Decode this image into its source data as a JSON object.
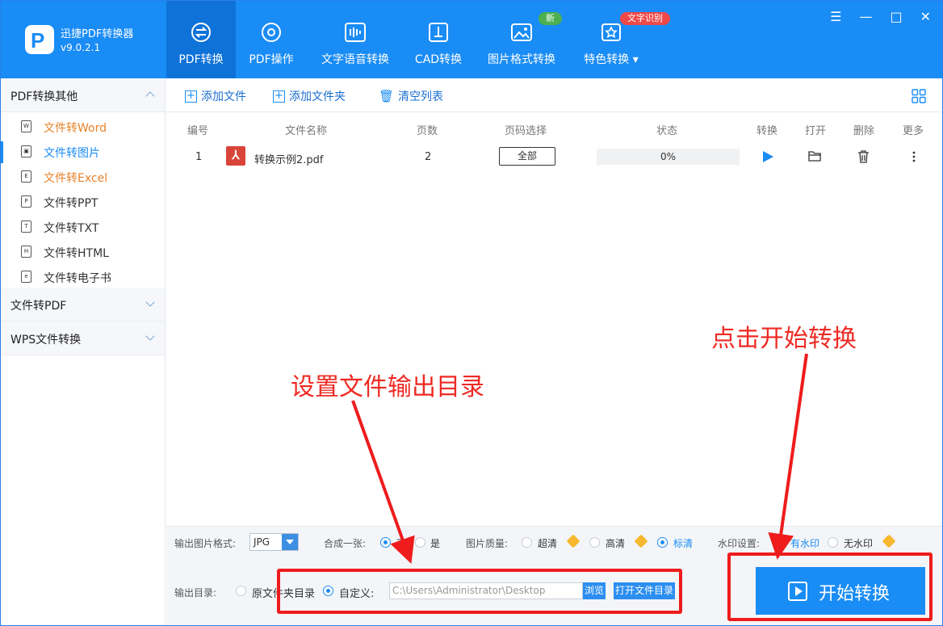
{
  "app": {
    "name": "迅捷PDF转换器",
    "version": "v9.0.2.1",
    "logo_letter": "P"
  },
  "tabs": [
    {
      "label": "PDF转换",
      "icon": "convert-icon"
    },
    {
      "label": "PDF操作",
      "icon": "settings-icon"
    },
    {
      "label": "文字语音转换",
      "icon": "audio-icon"
    },
    {
      "label": "CAD转换",
      "icon": "cad-icon"
    },
    {
      "label": "图片格式转换",
      "icon": "image-icon"
    },
    {
      "label": "特色转换",
      "icon": "star-icon"
    }
  ],
  "badges": {
    "new": "新",
    "ocr": "文字识别"
  },
  "window_controls": {
    "menu": "☰",
    "minimize": "—",
    "maximize": "□",
    "close": "✕"
  },
  "sidebar": {
    "group1": "PDF转换其他",
    "items": [
      {
        "label": "文件转Word",
        "icon_letter": "W"
      },
      {
        "label": "文件转图片",
        "icon_letter": "▣"
      },
      {
        "label": "文件转Excel",
        "icon_letter": "E"
      },
      {
        "label": "文件转PPT",
        "icon_letter": "P"
      },
      {
        "label": "文件转TXT",
        "icon_letter": "T"
      },
      {
        "label": "文件转HTML",
        "icon_letter": "H"
      },
      {
        "label": "文件转电子书",
        "icon_letter": "e"
      }
    ],
    "group2": "文件转PDF",
    "group3": "WPS文件转换"
  },
  "toolbar": {
    "add_file": "添加文件",
    "add_folder": "添加文件夹",
    "clear_list": "清空列表"
  },
  "table": {
    "headers": [
      "编号",
      "文件名称",
      "页数",
      "页码选择",
      "状态",
      "转换",
      "打开",
      "删除",
      "更多"
    ],
    "rows": [
      {
        "index": "1",
        "name": "转换示例2.pdf",
        "pages": "2",
        "page_select": "全部",
        "status": "0%"
      }
    ]
  },
  "options": {
    "format_label": "输出图片格式:",
    "format_value": "JPG",
    "merge_label": "合成一张:",
    "merge_no": "否",
    "merge_yes": "是",
    "quality_label": "图片质量:",
    "quality_options": [
      "超清",
      "高清",
      "标清"
    ],
    "quality_selected": "标清",
    "watermark_label": "水印设置:",
    "watermark_on": "有水印",
    "watermark_off": "无水印"
  },
  "output": {
    "label": "输出目录:",
    "original": "原文件夹目录",
    "custom": "自定义:",
    "path": "C:\\Users\\Administrator\\Desktop",
    "browse": "浏览",
    "open_dir": "打开文件目录"
  },
  "start_button": "开始转换",
  "annotations": {
    "set_output": "设置文件输出目录",
    "click_start": "点击开始转换"
  },
  "colors": {
    "brand": "#1a8cf5",
    "annotation": "#ee1c1c",
    "orange": "#e8822a"
  }
}
